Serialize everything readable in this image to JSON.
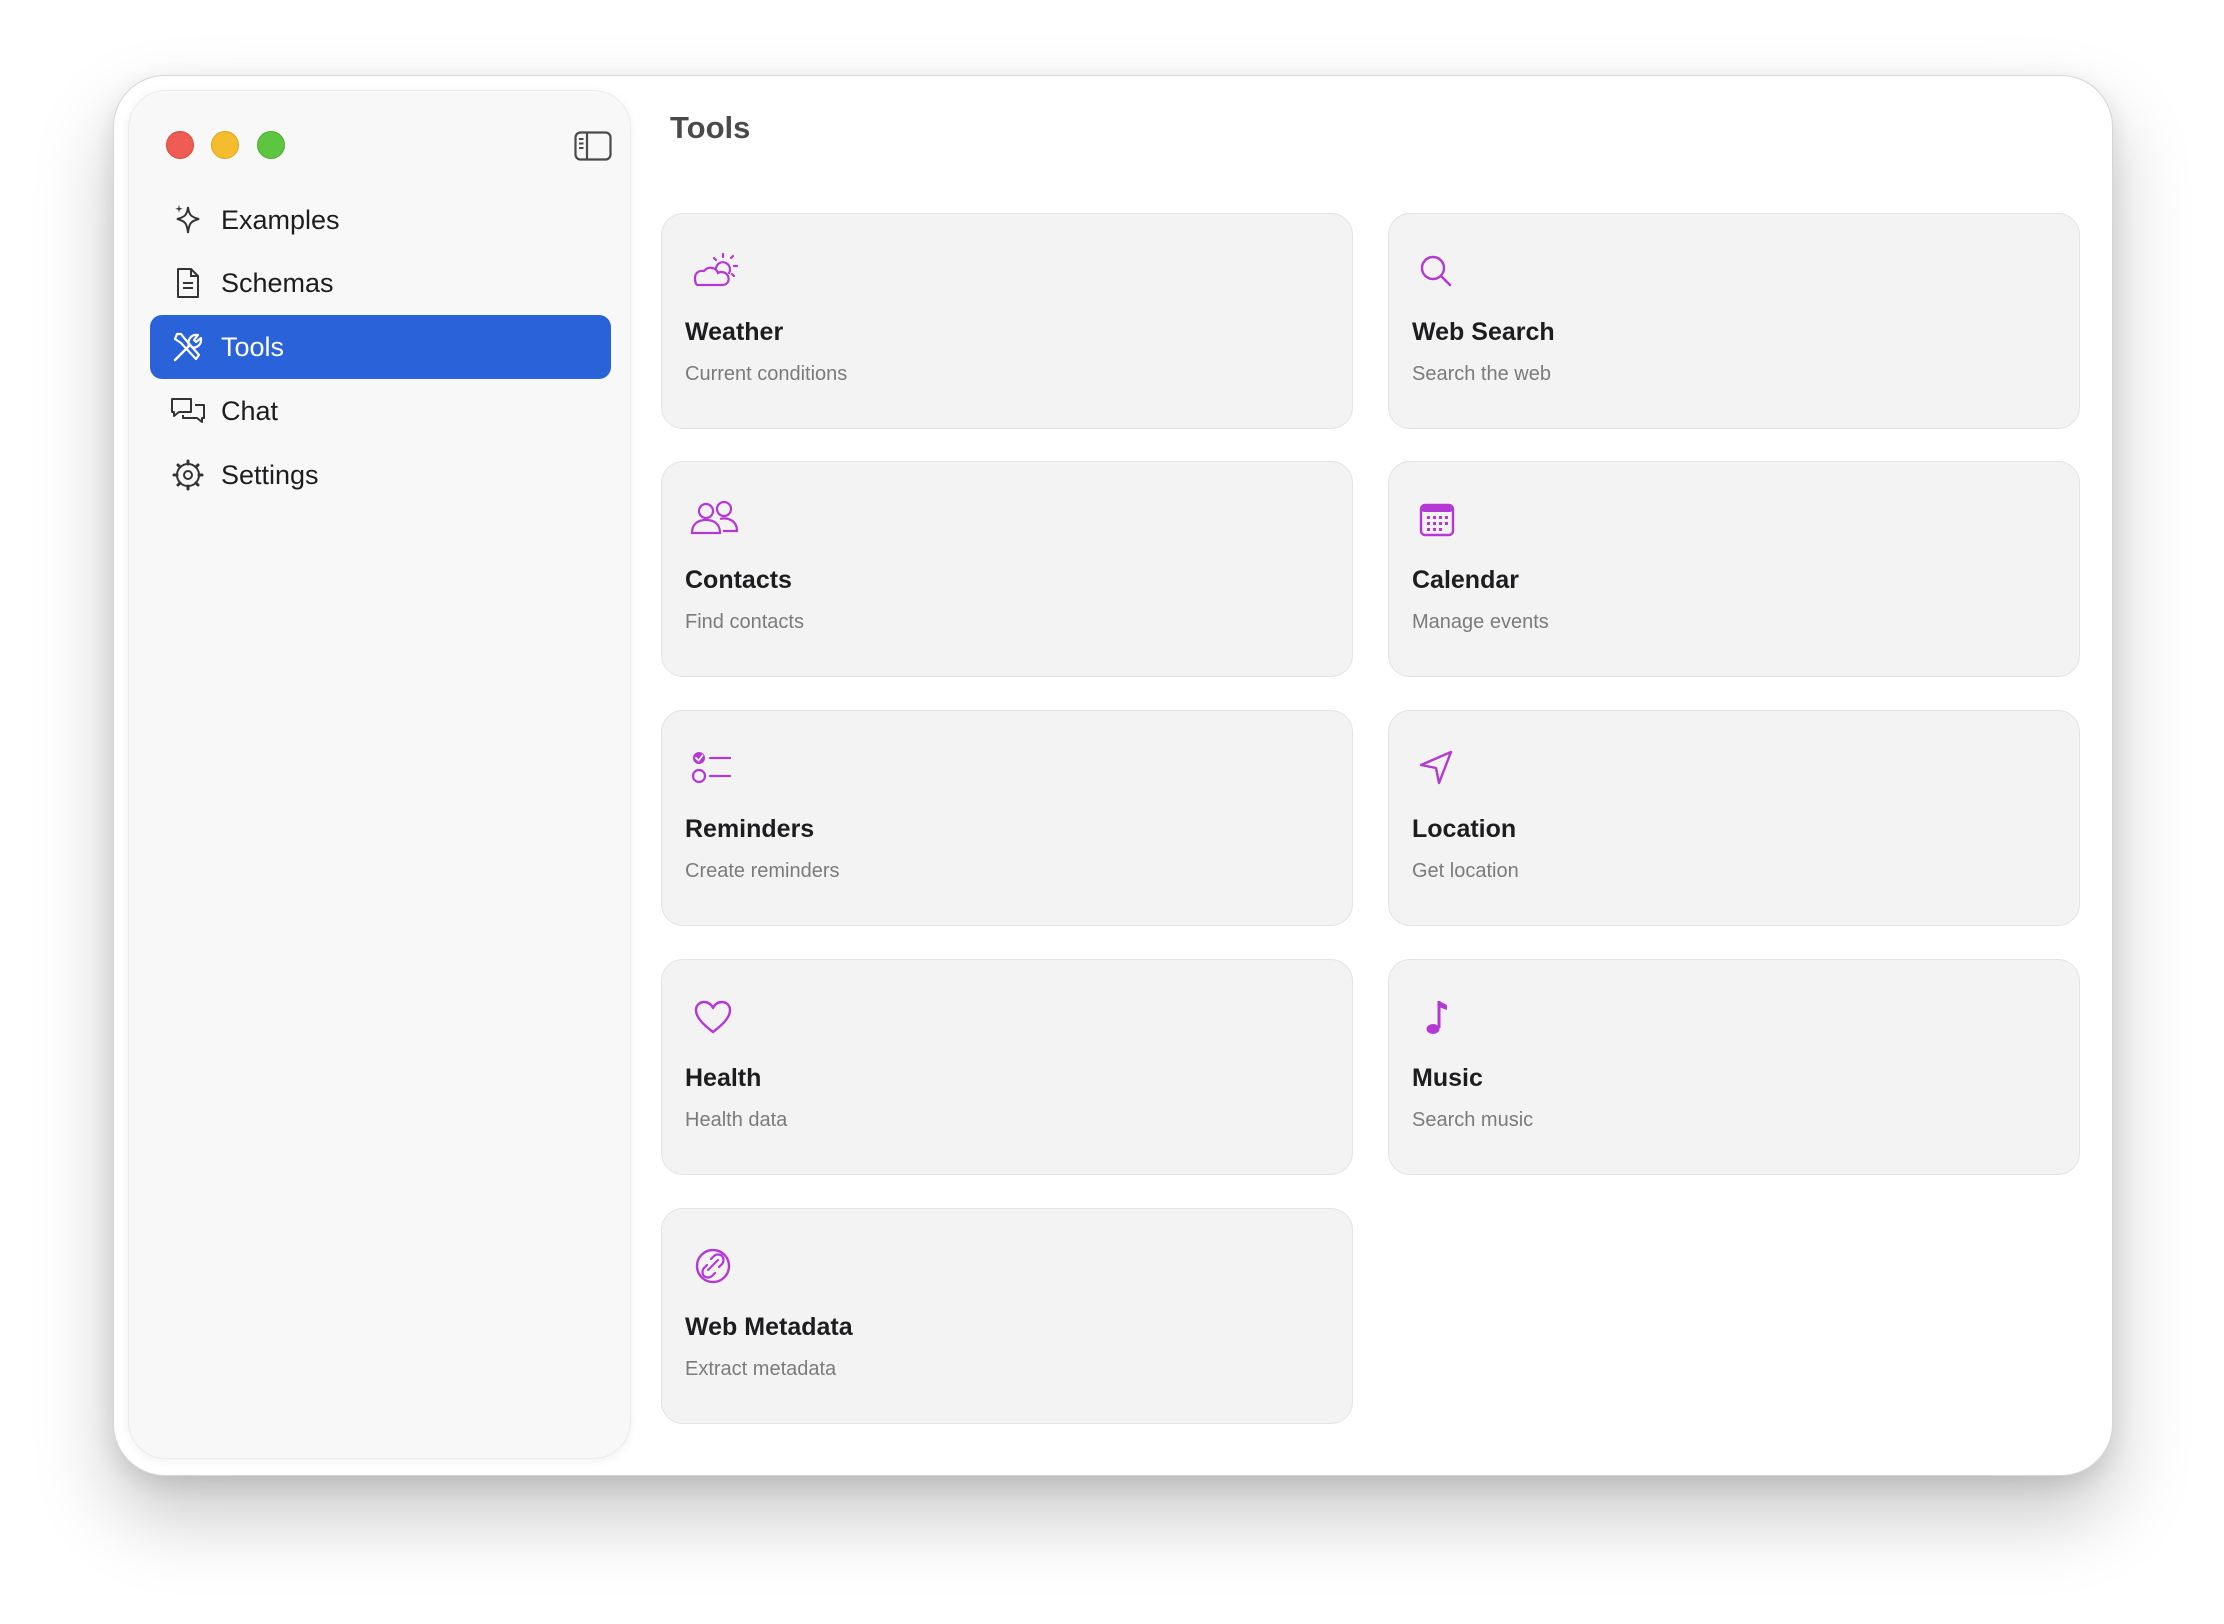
{
  "colors": {
    "accent": "#2a63d9",
    "icon_purple": "#b338d4",
    "card_bg": "#f3f3f3",
    "sidebar_bg": "#f8f8f8"
  },
  "sidebar": {
    "items": [
      {
        "label": "Examples",
        "icon": "sparkles-icon"
      },
      {
        "label": "Schemas",
        "icon": "document-icon"
      },
      {
        "label": "Tools",
        "icon": "tools-icon",
        "active": true
      },
      {
        "label": "Chat",
        "icon": "chat-bubbles-icon"
      },
      {
        "label": "Settings",
        "icon": "gear-icon"
      }
    ]
  },
  "main": {
    "title": "Tools",
    "cards": [
      {
        "title": "Weather",
        "subtitle": "Current conditions",
        "icon": "cloud-sun-icon"
      },
      {
        "title": "Web Search",
        "subtitle": "Search the web",
        "icon": "magnifier-icon"
      },
      {
        "title": "Contacts",
        "subtitle": "Find contacts",
        "icon": "people-icon"
      },
      {
        "title": "Calendar",
        "subtitle": "Manage events",
        "icon": "calendar-icon"
      },
      {
        "title": "Reminders",
        "subtitle": "Create reminders",
        "icon": "checklist-icon"
      },
      {
        "title": "Location",
        "subtitle": "Get location",
        "icon": "location-arrow-icon"
      },
      {
        "title": "Health",
        "subtitle": "Health data",
        "icon": "heart-icon"
      },
      {
        "title": "Music",
        "subtitle": "Search music",
        "icon": "music-note-icon"
      },
      {
        "title": "Web Metadata",
        "subtitle": "Extract metadata",
        "icon": "link-circle-icon"
      }
    ]
  }
}
